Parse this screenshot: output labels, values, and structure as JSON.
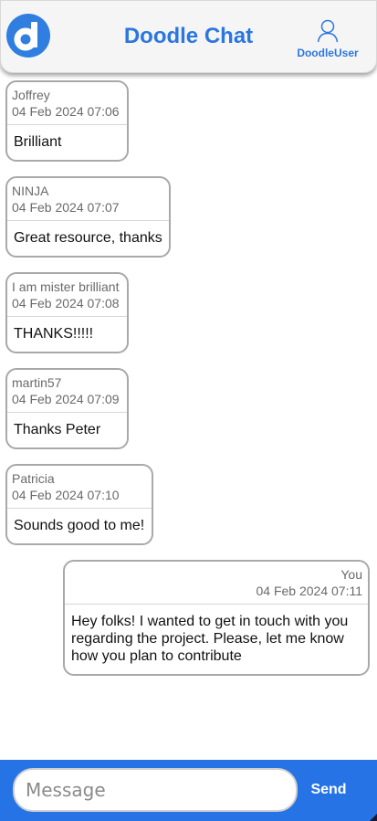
{
  "header": {
    "title": "Doodle Chat",
    "user_name": "DoodleUser",
    "logo_icon": "doodle-logo-icon",
    "user_icon": "user-icon"
  },
  "messages": [
    {
      "author": "Joffrey",
      "time": "04 Feb 2024 07:06",
      "text": "Brilliant",
      "mine": false
    },
    {
      "author": "NINJA",
      "time": "04 Feb 2024 07:07",
      "text": "Great resource, thanks",
      "mine": false
    },
    {
      "author": "I am mister brilliant",
      "time": "04 Feb 2024 07:08",
      "text": "THANKS!!!!!",
      "mine": false
    },
    {
      "author": "martin57",
      "time": "04 Feb 2024 07:09",
      "text": "Thanks Peter",
      "mine": false
    },
    {
      "author": "Patricia",
      "time": "04 Feb 2024 07:10",
      "text": "Sounds good to me!",
      "mine": false
    },
    {
      "author": "You",
      "time": "04 Feb 2024 07:11",
      "text": "Hey folks! I wanted to get in touch with you regarding the project. Please, let me know how you plan to contribute",
      "mine": true
    }
  ],
  "composer": {
    "placeholder": "Message",
    "value": "",
    "send_label": "Send"
  },
  "colors": {
    "accent": "#2b77df",
    "footer": "#2673e6",
    "bubble_border": "#a9a9a9"
  }
}
